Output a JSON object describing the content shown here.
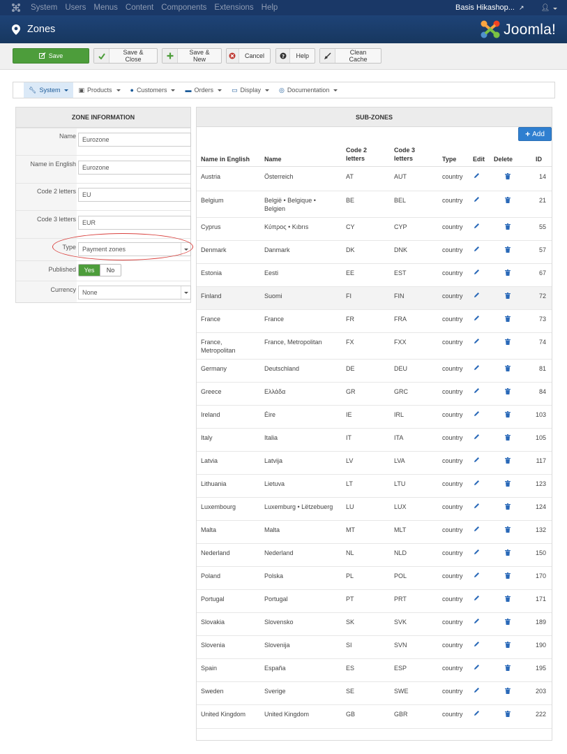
{
  "topnav": {
    "items": [
      "System",
      "Users",
      "Menus",
      "Content",
      "Components",
      "Extensions",
      "Help"
    ],
    "site_name": "Basis Hikashop..."
  },
  "title": {
    "text": "Zones",
    "brand": "Joomla!"
  },
  "toolbar": {
    "save": "Save",
    "save_close": "Save & Close",
    "save_new": "Save & New",
    "cancel": "Cancel",
    "help": "Help",
    "clean_cache": "Clean Cache"
  },
  "submenu": {
    "items": [
      "System",
      "Products",
      "Customers",
      "Orders",
      "Display",
      "Documentation"
    ],
    "active": "System"
  },
  "zone_info": {
    "heading": "ZONE INFORMATION",
    "fields": {
      "name": {
        "label": "Name",
        "value": "Eurozone"
      },
      "name_en": {
        "label": "Name in English",
        "value": "Eurozone"
      },
      "code2": {
        "label": "Code 2 letters",
        "value": "EU"
      },
      "code3": {
        "label": "Code 3 letters",
        "value": "EUR"
      },
      "type": {
        "label": "Type",
        "value": "Payment zones"
      },
      "published": {
        "label": "Published",
        "yes": "Yes",
        "no": "No",
        "selected": "Yes"
      },
      "currency": {
        "label": "Currency",
        "value": "None"
      }
    }
  },
  "subzones": {
    "heading": "SUB-ZONES",
    "add_label": "Add",
    "columns": {
      "name_en": "Name in English",
      "name": "Name",
      "code2_a": "Code 2",
      "code2_b": "letters",
      "code3_a": "Code 3",
      "code3_b": "letters",
      "type": "Type",
      "edit": "Edit",
      "delete": "Delete",
      "id": "ID"
    },
    "rows": [
      {
        "name_en": "Austria",
        "name": "Österreich",
        "code2": "AT",
        "code3": "AUT",
        "type": "country",
        "id": "14"
      },
      {
        "name_en": "Belgium",
        "name": "België • Belgique •",
        "name2": "Belgien",
        "code2": "BE",
        "code3": "BEL",
        "type": "country",
        "id": "21"
      },
      {
        "name_en": "Cyprus",
        "name": "Κύπρος • Kıbrıs",
        "code2": "CY",
        "code3": "CYP",
        "type": "country",
        "id": "55"
      },
      {
        "name_en": "Denmark",
        "name": "Danmark",
        "code2": "DK",
        "code3": "DNK",
        "type": "country",
        "id": "57"
      },
      {
        "name_en": "Estonia",
        "name": "Eesti",
        "code2": "EE",
        "code3": "EST",
        "type": "country",
        "id": "67"
      },
      {
        "name_en": "Finland",
        "name": "Suomi",
        "code2": "FI",
        "code3": "FIN",
        "type": "country",
        "id": "72"
      },
      {
        "name_en": "France",
        "name": "France",
        "code2": "FR",
        "code3": "FRA",
        "type": "country",
        "id": "73"
      },
      {
        "name_en": "France,",
        "name_en2": "Metropolitan",
        "name": "France, Metropolitan",
        "code2": "FX",
        "code3": "FXX",
        "type": "country",
        "id": "74"
      },
      {
        "name_en": "Germany",
        "name": "Deutschland",
        "code2": "DE",
        "code3": "DEU",
        "type": "country",
        "id": "81"
      },
      {
        "name_en": "Greece",
        "name": "Ελλάδα",
        "code2": "GR",
        "code3": "GRC",
        "type": "country",
        "id": "84"
      },
      {
        "name_en": "Ireland",
        "name": "Éire",
        "code2": "IE",
        "code3": "IRL",
        "type": "country",
        "id": "103"
      },
      {
        "name_en": "Italy",
        "name": "Italia",
        "code2": "IT",
        "code3": "ITA",
        "type": "country",
        "id": "105"
      },
      {
        "name_en": "Latvia",
        "name": "Latvija",
        "code2": "LV",
        "code3": "LVA",
        "type": "country",
        "id": "117"
      },
      {
        "name_en": "Lithuania",
        "name": "Lietuva",
        "code2": "LT",
        "code3": "LTU",
        "type": "country",
        "id": "123"
      },
      {
        "name_en": "Luxembourg",
        "name": "Luxemburg • Lëtzebuerg",
        "code2": "LU",
        "code3": "LUX",
        "type": "country",
        "id": "124"
      },
      {
        "name_en": "Malta",
        "name": "Malta",
        "code2": "MT",
        "code3": "MLT",
        "type": "country",
        "id": "132"
      },
      {
        "name_en": "Nederland",
        "name": "Nederland",
        "code2": "NL",
        "code3": "NLD",
        "type": "country",
        "id": "150"
      },
      {
        "name_en": "Poland",
        "name": "Polska",
        "code2": "PL",
        "code3": "POL",
        "type": "country",
        "id": "170"
      },
      {
        "name_en": "Portugal",
        "name": "Portugal",
        "code2": "PT",
        "code3": "PRT",
        "type": "country",
        "id": "171"
      },
      {
        "name_en": "Slovakia",
        "name": "Slovensko",
        "code2": "SK",
        "code3": "SVK",
        "type": "country",
        "id": "189"
      },
      {
        "name_en": "Slovenia",
        "name": "Slovenija",
        "code2": "SI",
        "code3": "SVN",
        "type": "country",
        "id": "190"
      },
      {
        "name_en": "Spain",
        "name": "España",
        "code2": "ES",
        "code3": "ESP",
        "type": "country",
        "id": "195"
      },
      {
        "name_en": "Sweden",
        "name": "Sverige",
        "code2": "SE",
        "code3": "SWE",
        "type": "country",
        "id": "203"
      },
      {
        "name_en": "United Kingdom",
        "name": "United Kingdom",
        "code2": "GB",
        "code3": "GBR",
        "type": "country",
        "id": "222"
      }
    ]
  },
  "colors": {
    "nav_bg": "#1a3867",
    "save_green": "#4d9d3b",
    "add_blue": "#2f7fd0",
    "icon_blue": "#2a69b8",
    "annotation_red": "#d9403d"
  }
}
